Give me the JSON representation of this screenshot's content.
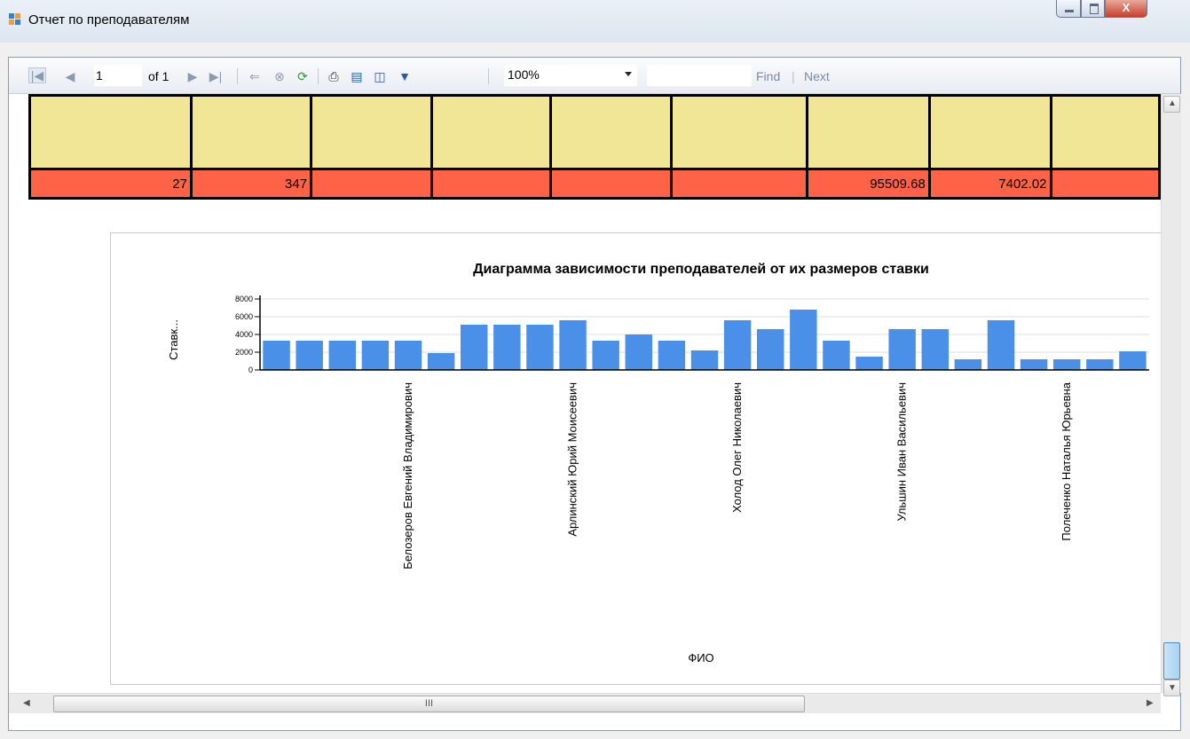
{
  "window": {
    "title": "Отчет по преподавателям",
    "close_label": "X"
  },
  "toolbar": {
    "page_current": "1",
    "page_of": "of 1",
    "zoom": "100%",
    "find_label": "Find",
    "next_label": "Next"
  },
  "table": {
    "totals_row": [
      "27",
      "347",
      "",
      "",
      "",
      "",
      "95509.68",
      "7402.02",
      ""
    ]
  },
  "chart_data": {
    "type": "bar",
    "title": "Диаграмма зависимости преподавателей от их размеров ставки",
    "xlabel": "ФИО",
    "ylabel": "Ставк...",
    "ylim": [
      0,
      8000
    ],
    "yticks": [
      0,
      2000,
      4000,
      6000,
      8000
    ],
    "categories": [
      "",
      "",
      "",
      "",
      "Белозеров Евгений Владимирович",
      "",
      "",
      "",
      "",
      "Арлинский Юрий Моисеевич",
      "",
      "",
      "",
      "",
      "Холод Олег Николаевич",
      "",
      "",
      "",
      "",
      "Ульшин Иван Васильевич",
      "",
      "",
      "",
      "",
      "Полеченко Наталья Юрьевна",
      "",
      ""
    ],
    "values": [
      3300,
      3300,
      3300,
      3300,
      3300,
      1900,
      5100,
      5100,
      5100,
      5600,
      3300,
      4000,
      3300,
      2200,
      5600,
      4600,
      6800,
      3300,
      1500,
      4600,
      4600,
      1200,
      5600,
      1200,
      1200,
      1200,
      2100
    ],
    "bar_color": "#4a8fe8"
  },
  "scroll": {
    "h_grip": "III"
  }
}
